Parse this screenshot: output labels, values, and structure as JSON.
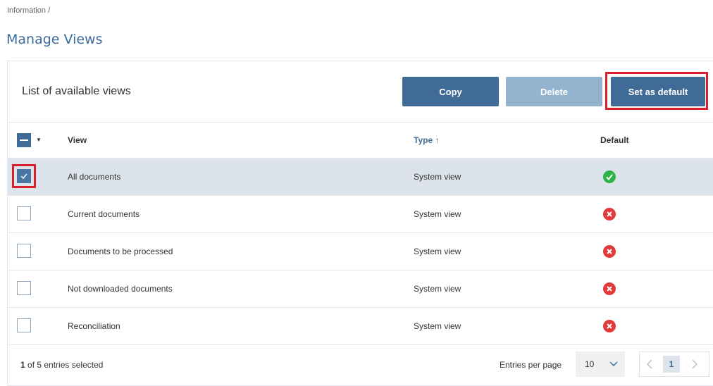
{
  "breadcrumb": "Information /",
  "page_title": "Manage Views",
  "panel": {
    "title": "List of available views",
    "buttons": {
      "copy": "Copy",
      "delete": "Delete",
      "set_default": "Set as default"
    }
  },
  "table": {
    "columns": {
      "view": "View",
      "type": "Type ↑",
      "default": "Default"
    },
    "rows": [
      {
        "view": "All documents",
        "type": "System view",
        "default": "yes",
        "selected": true
      },
      {
        "view": "Current documents",
        "type": "System view",
        "default": "no",
        "selected": false
      },
      {
        "view": "Documents to be processed",
        "type": "System view",
        "default": "no",
        "selected": false
      },
      {
        "view": "Not downloaded documents",
        "type": "System view",
        "default": "no",
        "selected": false
      },
      {
        "view": "Reconciliation",
        "type": "System view",
        "default": "no",
        "selected": false
      }
    ]
  },
  "footer": {
    "selected_count": "1",
    "selected_suffix": " of 5 entries selected",
    "entries_per_page_label": "Entries per page",
    "entries_per_page_value": "10",
    "current_page": "1"
  },
  "colors": {
    "accent": "#3f6b96",
    "success": "#2db34a",
    "error": "#e03a3a",
    "highlight": "#d9202a"
  },
  "icons": {
    "sort": "arrow-up-icon",
    "default_yes": "check-circle-icon",
    "default_no": "x-circle-icon"
  }
}
